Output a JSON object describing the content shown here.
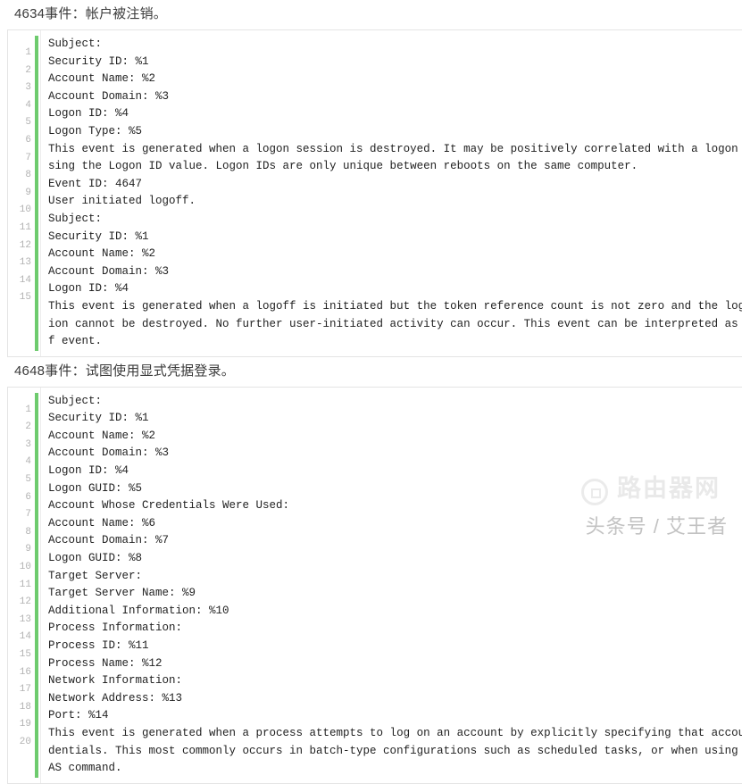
{
  "sections": [
    {
      "heading": "4634事件：帐户被注销。",
      "line_count": 15,
      "code": "Subject:\nSecurity ID: %1\nAccount Name: %2\nAccount Domain: %3\nLogon ID: %4\nLogon Type: %5\nThis event is generated when a logon session is destroyed. It may be positively correlated with a logon event u\nsing the Logon ID value. Logon IDs are only unique between reboots on the same computer.\nEvent ID: 4647\nUser initiated logoff.\nSubject:\nSecurity ID: %1\nAccount Name: %2\nAccount Domain: %3\nLogon ID: %4\nThis event is generated when a logoff is initiated but the token reference count is not zero and the logon sess\nion cannot be destroyed. No further user-initiated activity can occur. This event can be interpreted as a logof\nf event."
    },
    {
      "heading": "4648事件：试图使用显式凭据登录。",
      "line_count": 20,
      "code": "Subject:\nSecurity ID: %1\nAccount Name: %2\nAccount Domain: %3\nLogon ID: %4\nLogon GUID: %5\nAccount Whose Credentials Were Used:\nAccount Name: %6\nAccount Domain: %7\nLogon GUID: %8\nTarget Server:\nTarget Server Name: %9\nAdditional Information: %10\nProcess Information:\nProcess ID: %11\nProcess Name: %12\nNetwork Information:\nNetwork Address: %13\nPort: %14\nThis event is generated when a process attempts to log on an account by explicitly specifying that accounts cre\ndentials. This most commonly occurs in batch-type configurations such as scheduled tasks, or when using the RUN\nAS command."
    }
  ],
  "watermark": {
    "top_text": "路由器网",
    "bottom_text": "头条号 / 艾王者",
    "logo_icon": "ring-logo-icon"
  },
  "colors": {
    "accent_green": "#6ecb6e",
    "border": "#e4e4e4",
    "linenumber": "#b2b2b2",
    "code_text": "#222222",
    "heading_text": "#3a3a3a"
  }
}
